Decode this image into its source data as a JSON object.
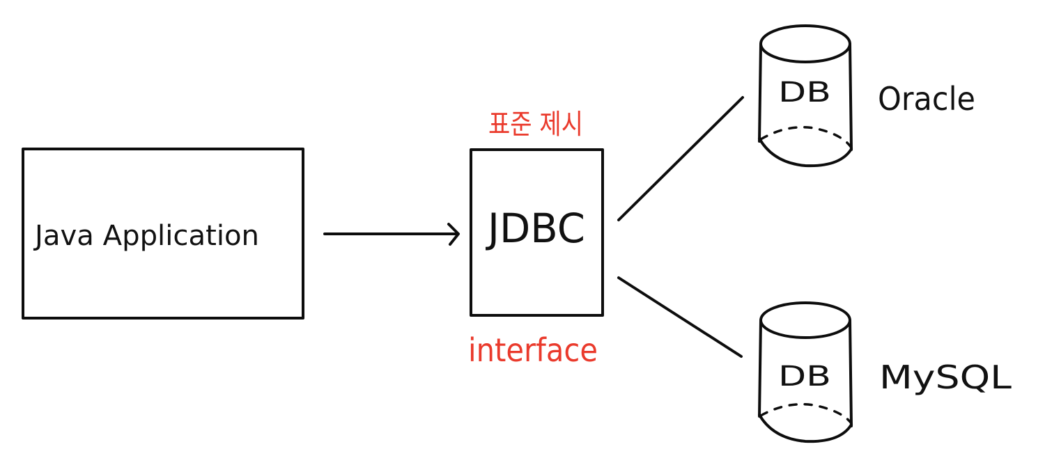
{
  "nodes": {
    "java_app": {
      "label": "Java Application"
    },
    "jdbc": {
      "label": "JDBC",
      "top_note": "표준 제시",
      "bottom_note": "interface"
    },
    "databases": [
      {
        "label": "DB",
        "vendor": "Oracle"
      },
      {
        "label": "DB",
        "vendor": "MySQL"
      }
    ]
  },
  "colors": {
    "ink": "#0d0d0d",
    "annotation": "#ea3a2c",
    "background": "#ffffff"
  }
}
